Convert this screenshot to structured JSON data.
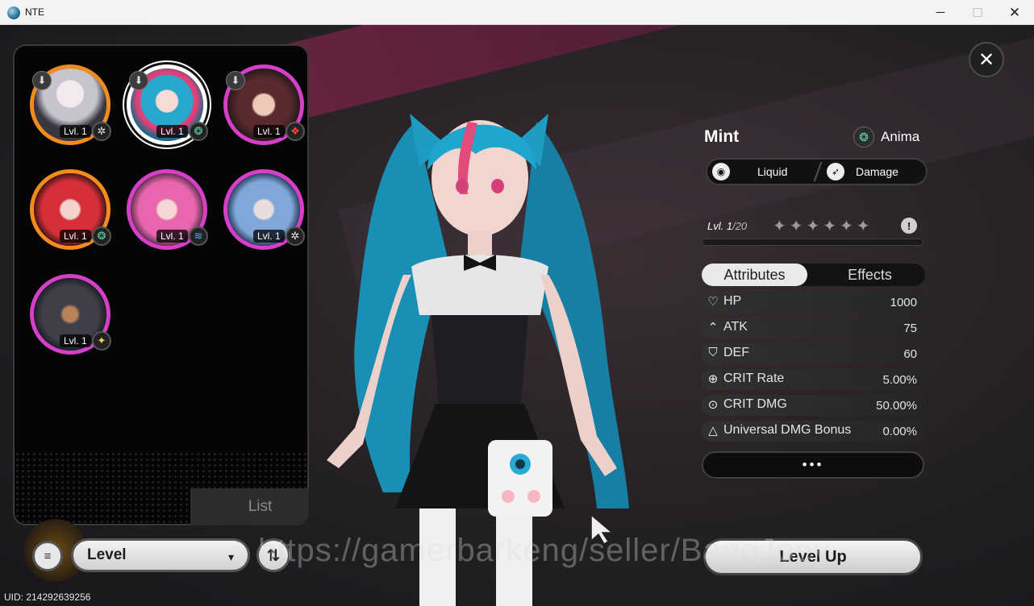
{
  "window": {
    "title": "NTE",
    "minimize": "─",
    "maximize": "☐",
    "close": "✕"
  },
  "game": {
    "close_glyph": "✕"
  },
  "roster": {
    "tab_label": "List",
    "characters": [
      {
        "level": "Lvl. 1",
        "element_icon": "gear-icon",
        "rarity": "orange",
        "download_glyph": "⬇",
        "element_glyph": "✲"
      },
      {
        "level": "Lvl. 1",
        "element_icon": "anima-icon",
        "rarity": "purple",
        "download_glyph": "⬇",
        "element_glyph": "❂",
        "selected": true
      },
      {
        "level": "Lvl. 1",
        "element_icon": "flame-icon",
        "rarity": "purple",
        "download_glyph": "⬇",
        "element_glyph": "❖"
      },
      {
        "level": "Lvl. 1",
        "element_icon": "anima-icon",
        "rarity": "orange",
        "element_glyph": "❂"
      },
      {
        "level": "Lvl. 1",
        "element_icon": "wave-icon",
        "rarity": "purple",
        "element_glyph": "≋"
      },
      {
        "level": "Lvl. 1",
        "element_icon": "gear-icon",
        "rarity": "purple",
        "element_glyph": "✲"
      },
      {
        "level": "Lvl. 1",
        "element_icon": "star-burst-icon",
        "rarity": "purple",
        "element_glyph": "✦"
      }
    ]
  },
  "controls": {
    "filter_glyph": "≡",
    "sort_label": "Level",
    "sort_chevron": "▾",
    "order_glyph": "⇅",
    "uid": "UID: 214292639256"
  },
  "detail": {
    "name": "Mint",
    "faction": "Anima",
    "faction_glyph": "❂",
    "type_1": "Liquid",
    "type_1_glyph": "◉",
    "type_2": "Damage",
    "type_2_glyph": "➶",
    "level_current": "Lvl. 1",
    "level_max": "/20",
    "stars": "✦✦✦✦✦✦",
    "info_glyph": "!",
    "exp_fraction": 0,
    "tabs": {
      "attributes": "Attributes",
      "effects": "Effects"
    },
    "stats": [
      {
        "name": "HP",
        "value": "1000",
        "icon": "heart-icon",
        "glyph": "♡"
      },
      {
        "name": "ATK",
        "value": "75",
        "icon": "atk-icon",
        "glyph": "⌃"
      },
      {
        "name": "DEF",
        "value": "60",
        "icon": "shield-icon",
        "glyph": "⛉"
      },
      {
        "name": "CRIT Rate",
        "value": "5.00%",
        "icon": "crosshair-icon",
        "glyph": "⊕"
      },
      {
        "name": "CRIT DMG",
        "value": "50.00%",
        "icon": "target-icon",
        "glyph": "⊙"
      },
      {
        "name": "Universal DMG Bonus",
        "value": "0.00%",
        "icon": "triangle-icon",
        "glyph": "△"
      }
    ],
    "more_label": "•••",
    "level_up_label": "Level Up"
  },
  "overlay": {
    "watermark": "https://gamerbarkeng/seller/BangJoey"
  },
  "colors": {
    "accent_pink": "#d640c9",
    "accent_orange": "#f28c1d",
    "band": "#6e2440"
  }
}
